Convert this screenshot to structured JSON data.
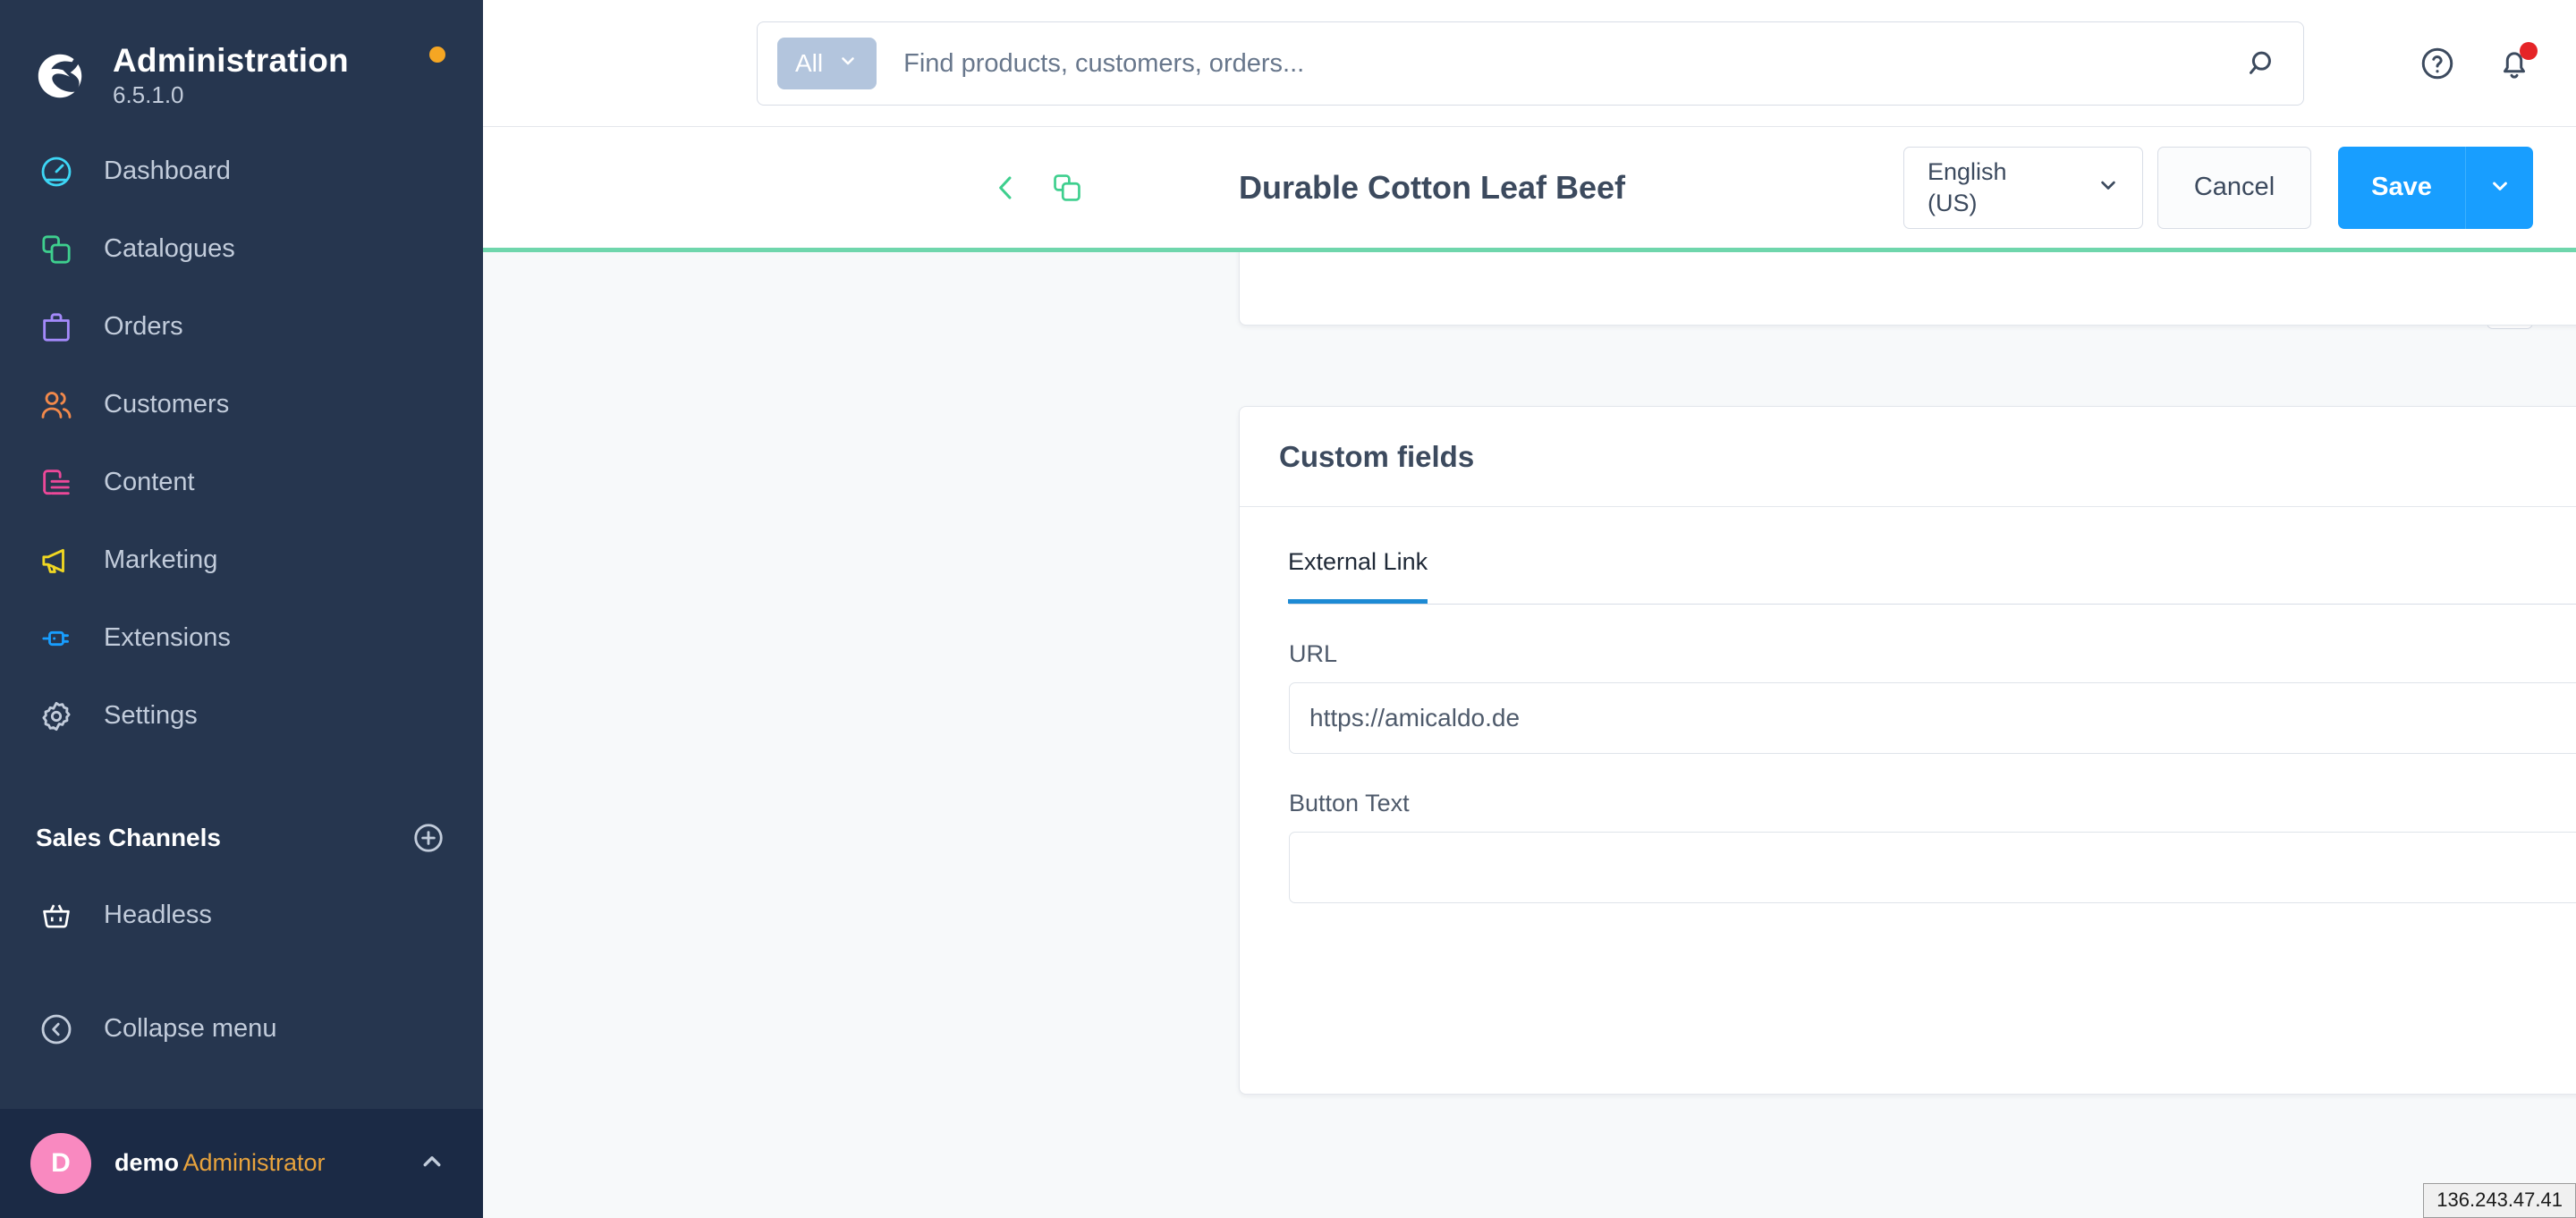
{
  "sidebar": {
    "brand": {
      "title": "Administration",
      "version": "6.5.1.0"
    },
    "nav": [
      {
        "label": "Dashboard",
        "icon": "dashboard-icon",
        "color": "#3dd6f5"
      },
      {
        "label": "Catalogues",
        "icon": "catalogues-icon",
        "color": "#3ecf8e"
      },
      {
        "label": "Orders",
        "icon": "orders-icon",
        "color": "#a48afb"
      },
      {
        "label": "Customers",
        "icon": "customers-icon",
        "color": "#f2894b"
      },
      {
        "label": "Content",
        "icon": "content-icon",
        "color": "#ec4899"
      },
      {
        "label": "Marketing",
        "icon": "marketing-icon",
        "color": "#f0d722"
      },
      {
        "label": "Extensions",
        "icon": "extensions-icon",
        "color": "#189eff"
      },
      {
        "label": "Settings",
        "icon": "settings-icon",
        "color": "#c2ccdb"
      }
    ],
    "sales_channels": {
      "title": "Sales Channels",
      "add_icon": "plus-circle-icon"
    },
    "channels": [
      {
        "label": "Headless",
        "icon": "basket-icon"
      }
    ],
    "collapse": {
      "label": "Collapse menu",
      "icon": "chevron-left-circle-icon"
    },
    "user": {
      "initial": "D",
      "name": "demo",
      "role": "Administrator",
      "caret_icon": "chevron-up-icon"
    }
  },
  "topbar": {
    "scope_label": "All",
    "scope_caret_icon": "chevron-down-icon",
    "search_placeholder": "Find products, customers, orders...",
    "search_value": "",
    "search_icon": "search-icon",
    "help_icon": "help-circle-icon",
    "notification_icon": "bell-icon"
  },
  "pagehead": {
    "back_icon": "chevron-left-icon",
    "entity_icon": "catalogues-icon",
    "title": "Durable Cotton Leaf Beef",
    "language": {
      "line1": "English",
      "line2": "(US)",
      "caret_icon": "chevron-down-icon"
    },
    "cancel_label": "Cancel",
    "save_label": "Save",
    "save_caret_icon": "chevron-down-icon"
  },
  "content": {
    "list_toggle_icon": "list-icon",
    "custom_fields": {
      "title": "Custom fields",
      "tabs": [
        {
          "label": "External Link",
          "active": true
        }
      ],
      "fields": [
        {
          "label": "URL",
          "value": "https://amicaldo.de",
          "placeholder": ""
        },
        {
          "label": "Button Text",
          "value": "",
          "placeholder": ""
        }
      ]
    }
  },
  "status": {
    "ip": "136.243.47.41"
  },
  "colors": {
    "sidebar_bg": "#26364f",
    "accent_blue": "#189eff",
    "accent_green": "#6fd6ac",
    "notification_red": "#e52427",
    "update_orange": "#f5a623"
  }
}
